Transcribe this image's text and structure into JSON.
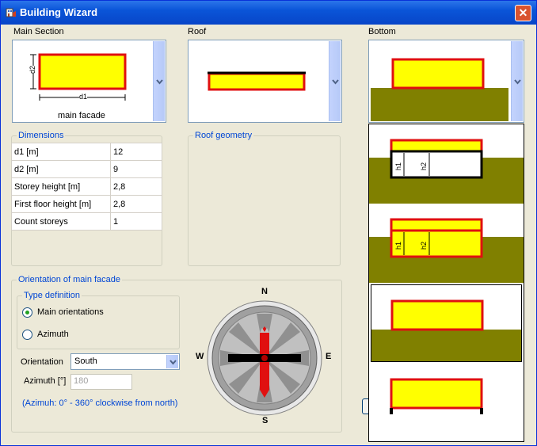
{
  "window": {
    "title": "Building Wizard",
    "close_label": "✕"
  },
  "main_section": {
    "label": "Main Section",
    "d1_label": "d1",
    "d2_label": "d2",
    "facade_label": "main facade"
  },
  "roof": {
    "label": "Roof"
  },
  "bottom": {
    "label": "Bottom"
  },
  "dimensions": {
    "title": "Dimensions",
    "rows": [
      {
        "label": "d1  [m]",
        "value": "12"
      },
      {
        "label": "d2  [m]",
        "value": "9"
      },
      {
        "label": "Storey height  [m]",
        "value": "2,8"
      },
      {
        "label": "First floor height  [m]",
        "value": "2,8"
      },
      {
        "label": "Count storeys",
        "value": "1"
      }
    ]
  },
  "roof_geometry": {
    "title": "Roof geometry"
  },
  "orientation": {
    "title": "Orientation of main facade",
    "type_definition": "Type definition",
    "option_main": "Main orientations",
    "option_azimuth": "Azimuth",
    "orientation_label": "Orientation",
    "orientation_value": "South",
    "azimuth_label": "Azimuth [°]",
    "azimuth_value": "180",
    "hint": "(Azimuh: 0° - 360° clockwise from north)"
  },
  "compass": {
    "n": "N",
    "e": "E",
    "s": "S",
    "w": "W"
  },
  "bottom_options": [
    {
      "h1": "h1",
      "h2": "h2"
    },
    {
      "h1": "h1",
      "h2": "h2"
    }
  ],
  "colors": {
    "yellow": "#ffff00",
    "red": "#e01010",
    "ground": "#808000",
    "accent": "#0046d5"
  }
}
